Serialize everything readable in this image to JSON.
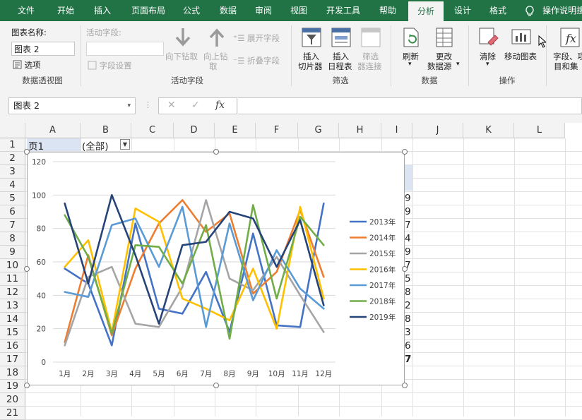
{
  "tabs": [
    "文件",
    "开始",
    "插入",
    "页面布局",
    "公式",
    "数据",
    "审阅",
    "视图",
    "开发工具",
    "帮助",
    "分析",
    "设计",
    "格式",
    "操作说明搜"
  ],
  "active_tab": "分析",
  "ribbon": {
    "chart_name_label": "图表名称:",
    "chart_name_value": "图表 2",
    "options_label": "选项",
    "group_pivot": "数据透视图",
    "active_field_label": "活动字段:",
    "field_settings": "字段设置",
    "drill_down_1": "向下钻取",
    "drill_up_1": "向上钻",
    "drill_up_2": "取",
    "expand_field": "展开字段",
    "collapse_field": "折叠字段",
    "group_active_field": "活动字段",
    "insert_slicer_1": "插入",
    "insert_slicer_2": "切片器",
    "insert_timeline_1": "插入",
    "insert_timeline_2": "日程表",
    "filter_conn_1": "筛选",
    "filter_conn_2": "器连接",
    "group_filter": "筛选",
    "refresh": "刷新",
    "change_source_1": "更改",
    "change_source_2": "数据源",
    "group_data": "数据",
    "clear": "清除",
    "move_chart": "移动图表",
    "group_actions": "操作",
    "fields_items_1": "字段、项",
    "fields_items_2": "目和集"
  },
  "formula_bar": {
    "name_box": "图表 2",
    "fx": "fx",
    "content": ""
  },
  "columns": [
    "A",
    "B",
    "C",
    "D",
    "E",
    "F",
    "G",
    "H",
    "I",
    "J",
    "K",
    "L"
  ],
  "rows": [
    "1",
    "2",
    "3",
    "4",
    "5",
    "6",
    "7",
    "8",
    "9",
    "10",
    "11",
    "12",
    "13",
    "14",
    "15",
    "16",
    "17",
    "18",
    "19",
    "20",
    "21"
  ],
  "cells": {
    "a1": "页1",
    "b1": "(全部)",
    "i_values": [
      "9",
      "9",
      "7",
      "4",
      "9",
      "7",
      "5",
      "8",
      "2",
      "8",
      "3",
      "6",
      "7"
    ]
  },
  "chart_data": {
    "type": "line",
    "categories": [
      "1月",
      "2月",
      "3月",
      "4月",
      "5月",
      "6月",
      "7月",
      "8月",
      "9月",
      "10月",
      "11月",
      "12月"
    ],
    "ylim": [
      0,
      120
    ],
    "yticks": [
      0,
      20,
      40,
      60,
      80,
      100,
      120
    ],
    "grid": true,
    "legend_position": "right",
    "series": [
      {
        "name": "2013年",
        "color": "#4472c4",
        "values": [
          56,
          47,
          10,
          83,
          32,
          29,
          54,
          18,
          77,
          22,
          21,
          95
        ]
      },
      {
        "name": "2014年",
        "color": "#ed7d31",
        "values": [
          12,
          64,
          16,
          56,
          83,
          97,
          78,
          89,
          41,
          54,
          91,
          51
        ]
      },
      {
        "name": "2015年",
        "color": "#a5a5a5",
        "values": [
          10,
          51,
          57,
          23,
          21,
          45,
          97,
          50,
          43,
          63,
          40,
          18
        ]
      },
      {
        "name": "2016年",
        "color": "#ffc000",
        "values": [
          57,
          73,
          18,
          92,
          84,
          38,
          32,
          25,
          56,
          20,
          93,
          38
        ]
      },
      {
        "name": "2017年",
        "color": "#5b9bd5",
        "values": [
          42,
          39,
          82,
          86,
          57,
          93,
          21,
          83,
          37,
          67,
          44,
          32
        ]
      },
      {
        "name": "2018年",
        "color": "#70ad47",
        "values": [
          88,
          63,
          17,
          70,
          69,
          47,
          82,
          14,
          94,
          38,
          87,
          70
        ]
      },
      {
        "name": "2019年",
        "color": "#264478",
        "values": [
          95,
          47,
          100,
          64,
          23,
          70,
          72,
          90,
          86,
          57,
          85,
          34
        ]
      }
    ]
  }
}
